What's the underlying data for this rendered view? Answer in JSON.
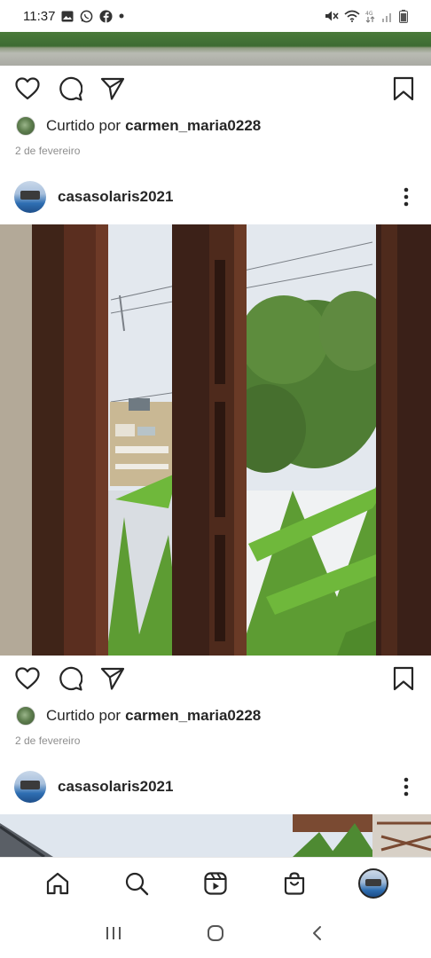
{
  "status_bar": {
    "time": "11:37",
    "left_icons": [
      "gallery-icon",
      "whatsapp-icon",
      "facebook-icon",
      "dot-icon"
    ],
    "right_icons": [
      "mute-icon",
      "wifi-icon",
      "mobile-data-icon",
      "signal-icon",
      "battery-icon"
    ]
  },
  "posts": [
    {
      "likes": {
        "prefix": "Curtido por",
        "user": "carmen_maria0228"
      },
      "date": "2 de fevereiro"
    },
    {
      "username": "casasolaris2021",
      "likes": {
        "prefix": "Curtido por",
        "user": "carmen_maria0228"
      },
      "date": "2 de fevereiro"
    },
    {
      "username": "casasolaris2021"
    }
  ],
  "bottom_nav": [
    "home-icon",
    "search-icon",
    "reels-icon",
    "shop-icon",
    "profile-avatar"
  ],
  "system_nav": [
    "recent-apps-icon",
    "home-circle-icon",
    "back-icon"
  ],
  "colors": {
    "text": "#262626",
    "muted": "#8e8e8e",
    "background": "#ffffff"
  }
}
